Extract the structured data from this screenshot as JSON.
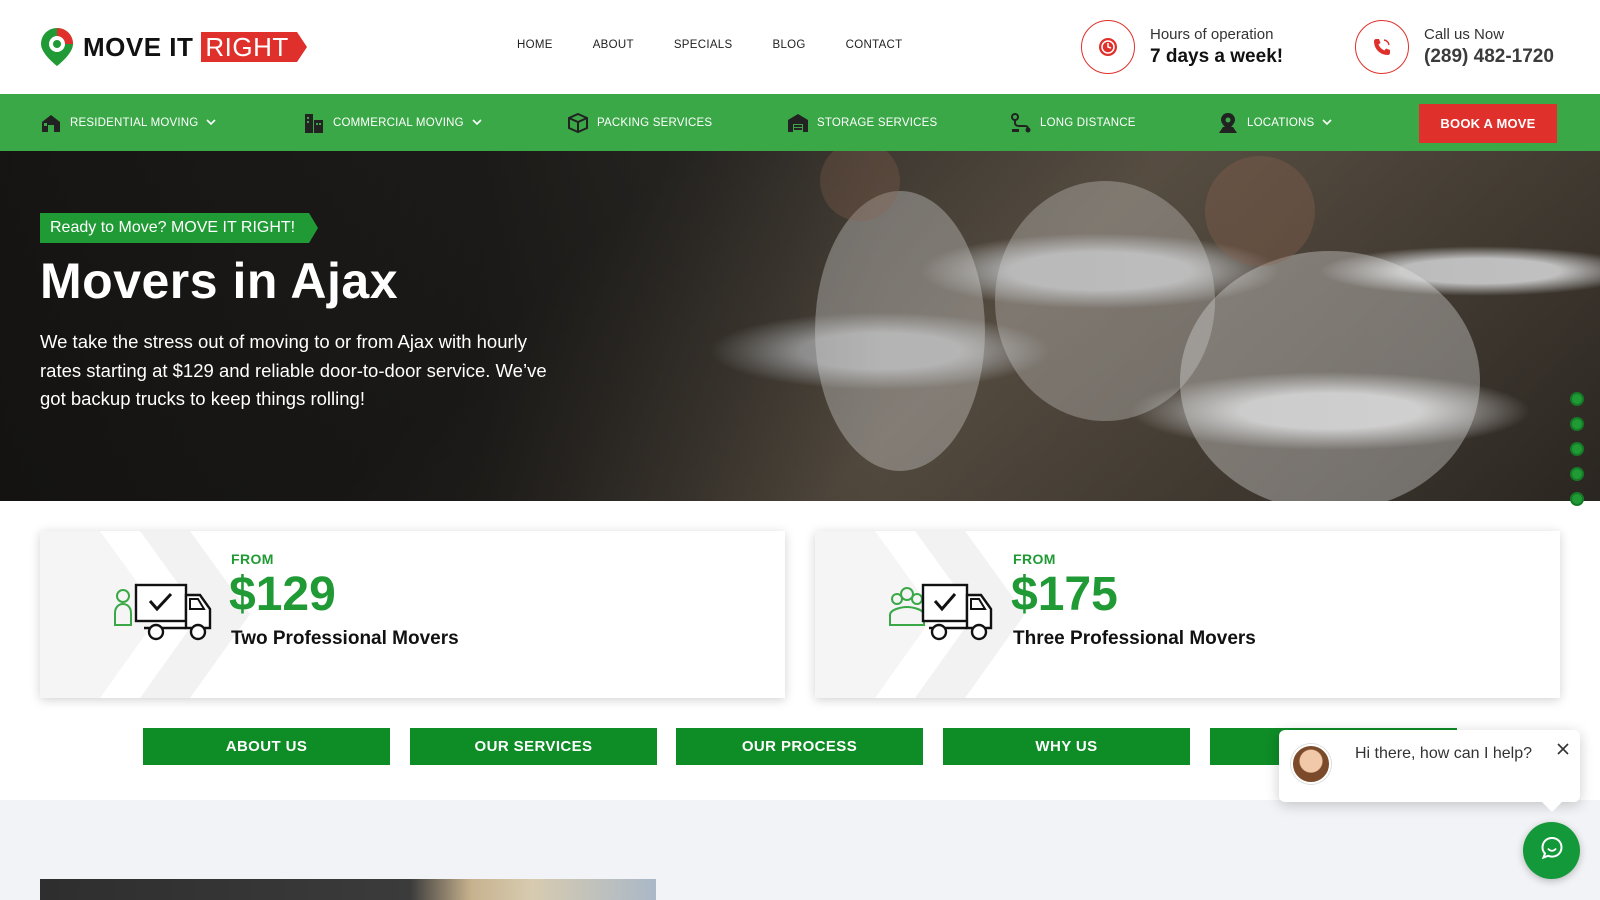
{
  "header": {
    "logo": {
      "part1": "MOVE IT",
      "part2": "RIGHT"
    },
    "nav": [
      "HOME",
      "ABOUT",
      "SPECIALS",
      "BLOG",
      "CONTACT"
    ],
    "hours": {
      "label": "Hours of operation",
      "value": "7 days a week!",
      "icon": "clock-icon"
    },
    "phone": {
      "label": "Call us Now",
      "value": "(289) 482-1720",
      "icon": "phone-icon"
    }
  },
  "green_nav": {
    "items": [
      {
        "label": "RESIDENTIAL MOVING",
        "icon": "house-icon",
        "dropdown": true
      },
      {
        "label": "COMMERCIAL MOVING",
        "icon": "building-icon",
        "dropdown": true
      },
      {
        "label": "PACKING SERVICES",
        "icon": "box-icon",
        "dropdown": false
      },
      {
        "label": "STORAGE SERVICES",
        "icon": "warehouse-icon",
        "dropdown": false
      },
      {
        "label": "LONG DISTANCE",
        "icon": "route-icon",
        "dropdown": false
      },
      {
        "label": "LOCATIONS",
        "icon": "location-icon",
        "dropdown": true
      }
    ],
    "book_label": "BOOK A MOVE"
  },
  "hero": {
    "tag": "Ready to Move? MOVE IT RIGHT!",
    "title": "Movers in Ajax",
    "description": "We take the stress out of moving to or from Ajax with hourly rates starting at $129 and reliable door-to-door service. We’ve got backup trucks to keep things rolling!",
    "slide_dots": 5
  },
  "pricing": [
    {
      "from": "FROM",
      "price": "$129",
      "label": "Two Professional Movers"
    },
    {
      "from": "FROM",
      "price": "$175",
      "label": "Three Professional Movers"
    }
  ],
  "section_buttons": [
    "ABOUT US",
    "OUR SERVICES",
    "OUR PROCESS",
    "WHY US",
    ""
  ],
  "chat": {
    "message": "Hi there, how can I help?"
  },
  "colors": {
    "green": "#3aa847",
    "dark_green": "#0e8c26",
    "red": "#e0302b"
  }
}
